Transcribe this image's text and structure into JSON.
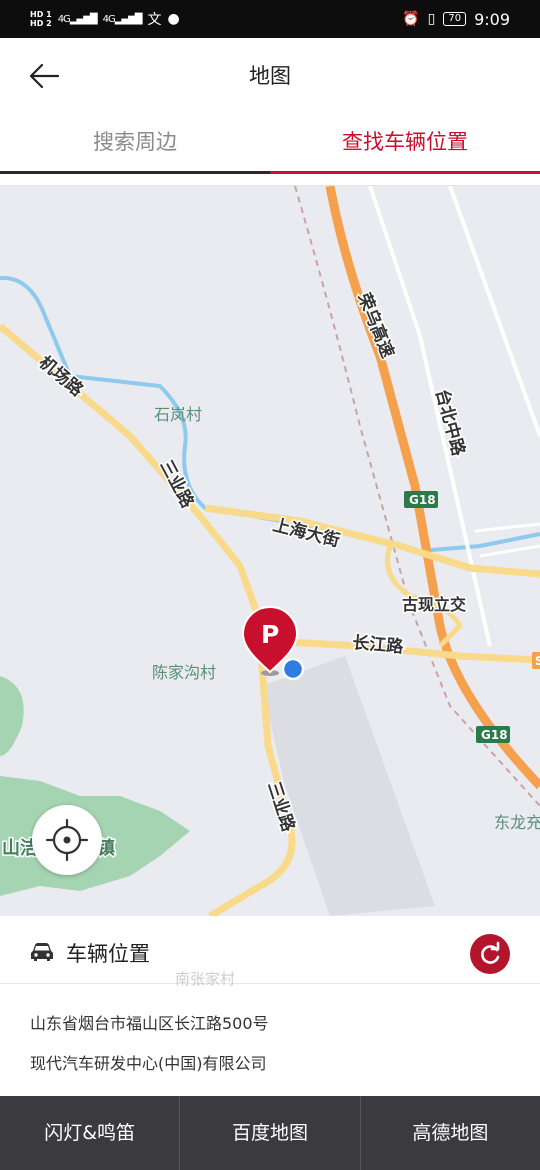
{
  "status_bar": {
    "hd1": "HD 1",
    "hd2": "HD 2",
    "net1": "4G",
    "net2": "4G",
    "battery": "70",
    "time": "9:09"
  },
  "header": {
    "title": "地图"
  },
  "tabs": [
    {
      "label": "搜索周边",
      "active": false
    },
    {
      "label": "查找车辆位置",
      "active": true
    }
  ],
  "map": {
    "labels": {
      "airport_road": "机场路",
      "shilan_village": "石岚村",
      "sanye_road_upper": "三业路",
      "shanghai_street": "上海大街",
      "rongwu_expressway": "荣乌高速",
      "taibei_middle_road": "台北中路",
      "g18_upper": "G18",
      "g18_lower": "G18",
      "guxian_interchange": "古现立交",
      "changjiang_road": "长江路",
      "chenjiagou_village": "陈家沟村",
      "sanye_road_lower": "三业路",
      "donglong": "东龙充",
      "town_partial": "山洁",
      "town_suffix": "镇",
      "nanzhang_village": "南张家村",
      "s_marker": "S"
    },
    "pin_letter": "P",
    "colors": {
      "expressway": "#f5a04c",
      "road_major": "#f9d98a",
      "river": "#8ec9ee",
      "pin": "#c8102e",
      "vehicle_dot": "#2f7de1",
      "green_area": "#a5d4b3"
    }
  },
  "vehicle_panel": {
    "title": "车辆位置",
    "address_line1": "山东省烟台市福山区长江路500号",
    "address_line2": "现代汽车研发中心(中国)有限公司"
  },
  "bottom_actions": [
    {
      "label": "闪灯&鸣笛"
    },
    {
      "label": "百度地图"
    },
    {
      "label": "高德地图"
    }
  ],
  "accent_color": "#c8102e"
}
